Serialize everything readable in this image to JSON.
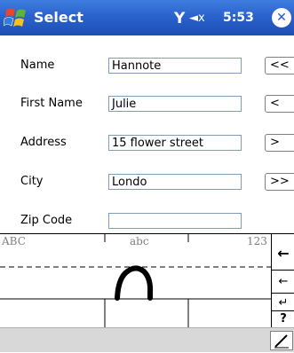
{
  "titlebar": {
    "title": "Select",
    "time": "5:53",
    "signal_icon": "Y",
    "volume_icon": "◄x",
    "ok_glyph": "✕"
  },
  "form": {
    "fields": [
      {
        "label": "Name",
        "value": "Hannote",
        "button": "<<"
      },
      {
        "label": "First Name",
        "value": "Julie",
        "button": "<"
      },
      {
        "label": "Address",
        "value": "15 flower street",
        "button": ">"
      },
      {
        "label": "City",
        "value": "Londo",
        "button": ">>"
      },
      {
        "label": "Zip Code",
        "value": ""
      }
    ]
  },
  "input_panel": {
    "modes": [
      "ABC",
      "abc",
      "123"
    ],
    "keys": [
      "←",
      "←",
      "↵",
      "?",
      "/"
    ]
  },
  "colors": {
    "titlebar": "#2a62cc",
    "field_border": "#7f9db9"
  }
}
